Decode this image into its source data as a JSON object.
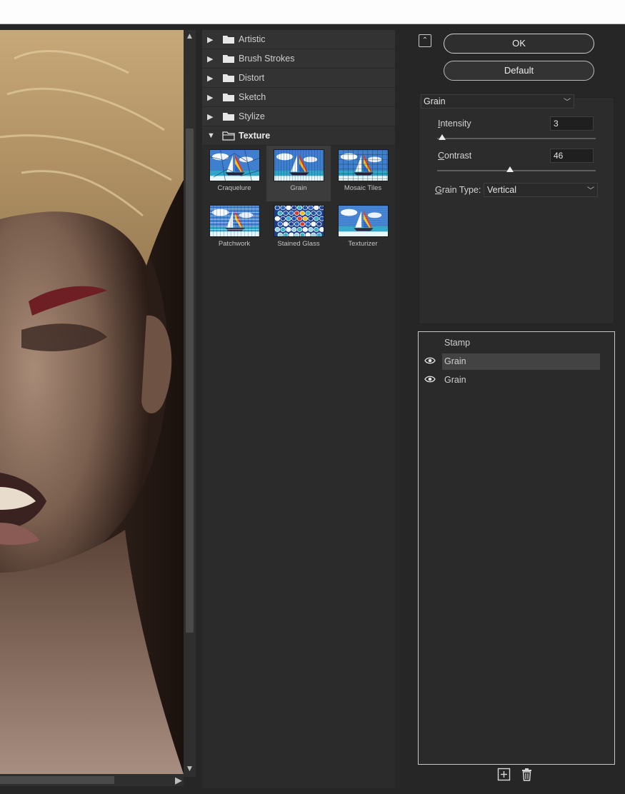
{
  "categories": [
    {
      "label": "Artistic",
      "open": false
    },
    {
      "label": "Brush Strokes",
      "open": false
    },
    {
      "label": "Distort",
      "open": false
    },
    {
      "label": "Sketch",
      "open": false
    },
    {
      "label": "Stylize",
      "open": false
    },
    {
      "label": "Texture",
      "open": true
    }
  ],
  "texture_filters": [
    {
      "label": "Craquelure",
      "selected": false,
      "style": "craquelure"
    },
    {
      "label": "Grain",
      "selected": true,
      "style": "grain"
    },
    {
      "label": "Mosaic Tiles",
      "selected": false,
      "style": "mosaic"
    },
    {
      "label": "Patchwork",
      "selected": false,
      "style": "patchwork"
    },
    {
      "label": "Stained Glass",
      "selected": false,
      "style": "stained"
    },
    {
      "label": "Texturizer",
      "selected": false,
      "style": "texturizer"
    }
  ],
  "buttons": {
    "ok": "OK",
    "default": "Default"
  },
  "filter_select": {
    "value": "Grain"
  },
  "params": {
    "intensity": {
      "label_first": "I",
      "label_rest": "ntensity",
      "value": "3",
      "fraction": 0.03
    },
    "contrast": {
      "label_first": "C",
      "label_rest": "ontrast",
      "value": "46",
      "fraction": 0.46
    },
    "grain_type": {
      "label_first": "G",
      "label_rest": "rain Type:",
      "value": "Vertical"
    }
  },
  "layers": [
    {
      "name": "Stamp",
      "visible": false,
      "selected": false
    },
    {
      "name": "Grain",
      "visible": true,
      "selected": true
    },
    {
      "name": "Grain",
      "visible": true,
      "selected": false
    }
  ],
  "colors": {
    "panel": "#262626",
    "accent": "#ececec"
  },
  "icons": {
    "new_layer": "add-layer-icon",
    "delete": "trash-icon",
    "collapse": "collapse-icon"
  }
}
